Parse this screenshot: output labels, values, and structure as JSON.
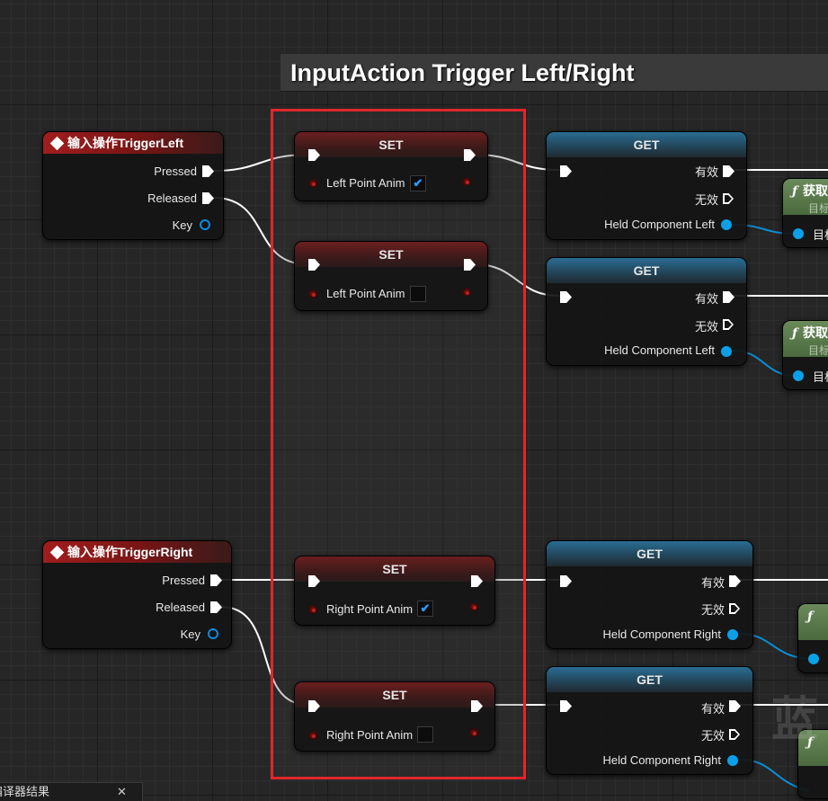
{
  "comment": {
    "title": "InputAction Trigger Left/Right"
  },
  "events": [
    {
      "title": "输入操作TriggerLeft",
      "pins": [
        "Pressed",
        "Released",
        "Key"
      ]
    },
    {
      "title": "输入操作TriggerRight",
      "pins": [
        "Pressed",
        "Released",
        "Key"
      ]
    }
  ],
  "set_nodes": [
    {
      "title": "SET",
      "var": "Left Point Anim",
      "checked": true
    },
    {
      "title": "SET",
      "var": "Left Point Anim",
      "checked": false
    },
    {
      "title": "SET",
      "var": "Right Point Anim",
      "checked": true
    },
    {
      "title": "SET",
      "var": "Right Point Anim",
      "checked": false
    }
  ],
  "get_nodes": [
    {
      "title": "GET",
      "valid": "有效",
      "invalid": "无效",
      "component": "Held Component Left"
    },
    {
      "title": "GET",
      "valid": "有效",
      "invalid": "无效",
      "component": "Held Component Left"
    },
    {
      "title": "GET",
      "valid": "有效",
      "invalid": "无效",
      "component": "Held Component Right"
    },
    {
      "title": "GET",
      "valid": "有效",
      "invalid": "无效",
      "component": "Held Component Right"
    }
  ],
  "func_nodes": [
    {
      "title": "获取",
      "sub": "目标",
      "pin": "目标"
    },
    {
      "title": "获取",
      "sub": "目标",
      "pin": "目标"
    },
    {
      "title": "",
      "sub": "",
      "pin": ""
    },
    {
      "title": "",
      "sub": "",
      "pin": ""
    }
  ],
  "bottom_tab": {
    "label": "编译器结果",
    "close": "✕"
  },
  "watermark": "蓝",
  "colors": {
    "selection": "#e0262a",
    "exec": "#ffffff",
    "object_pin": "#0aa0e8",
    "bool_pin": "#8b1010"
  },
  "icons": {
    "event": "event-diamond-icon",
    "func": "function-f-icon",
    "check": "checkmark-icon"
  }
}
